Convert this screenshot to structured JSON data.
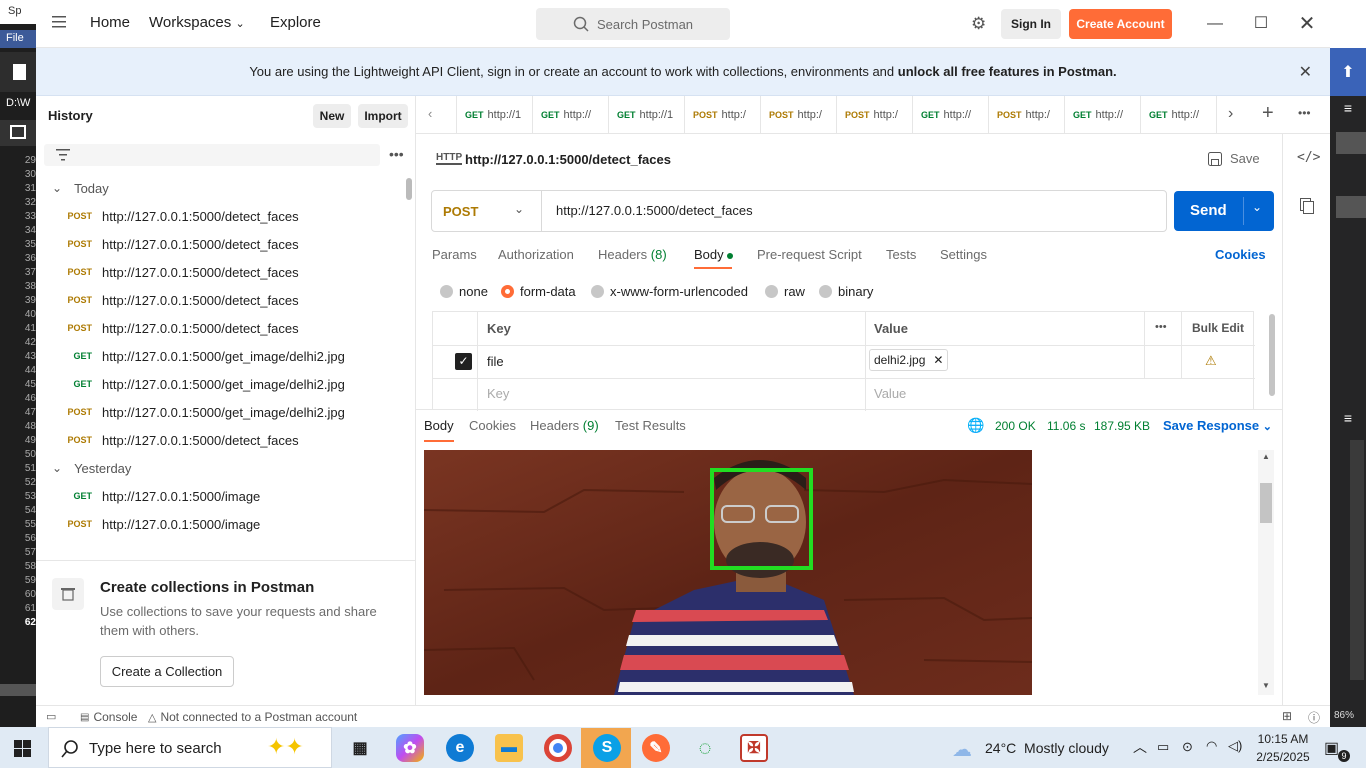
{
  "background_app": {
    "title_prefix": "Sp",
    "menu_file": "File",
    "path_prefix": "D:\\W",
    "line_numbers": [
      "29",
      "30",
      "31",
      "32",
      "33",
      "34",
      "35",
      "36",
      "37",
      "38",
      "39",
      "40",
      "41",
      "42",
      "43",
      "44",
      "45",
      "46",
      "47",
      "48",
      "49",
      "50",
      "51",
      "52",
      "53",
      "54",
      "55",
      "56",
      "57",
      "58",
      "59",
      "60",
      "61",
      "62"
    ],
    "zoom": "86%"
  },
  "header": {
    "home": "Home",
    "workspaces": "Workspaces",
    "explore": "Explore",
    "search_placeholder": "Search Postman",
    "sign_in": "Sign In",
    "create_account": "Create Account"
  },
  "banner": {
    "text": "You are using the Lightweight API Client, sign in or create an account to work with collections, environments and ",
    "bold": "unlock all free features in Postman."
  },
  "sidebar": {
    "title": "History",
    "new_label": "New",
    "import_label": "Import",
    "groups": [
      {
        "label": "Today",
        "items": [
          {
            "method": "POST",
            "url": "http://127.0.0.1:5000/detect_faces"
          },
          {
            "method": "POST",
            "url": "http://127.0.0.1:5000/detect_faces"
          },
          {
            "method": "POST",
            "url": "http://127.0.0.1:5000/detect_faces"
          },
          {
            "method": "POST",
            "url": "http://127.0.0.1:5000/detect_faces"
          },
          {
            "method": "POST",
            "url": "http://127.0.0.1:5000/detect_faces"
          },
          {
            "method": "GET",
            "url": "http://127.0.0.1:5000/get_image/delhi2.jpg"
          },
          {
            "method": "GET",
            "url": "http://127.0.0.1:5000/get_image/delhi2.jpg"
          },
          {
            "method": "POST",
            "url": "http://127.0.0.1:5000/get_image/delhi2.jpg"
          },
          {
            "method": "POST",
            "url": "http://127.0.0.1:5000/detect_faces"
          }
        ]
      },
      {
        "label": "Yesterday",
        "items": [
          {
            "method": "GET",
            "url": "http://127.0.0.1:5000/image"
          },
          {
            "method": "POST",
            "url": "http://127.0.0.1:5000/image"
          }
        ]
      }
    ],
    "promo_title": "Create collections in Postman",
    "promo_text_1": "Use collections to save your requests and share",
    "promo_text_2": "them with others.",
    "promo_button": "Create a Collection"
  },
  "tabs": [
    {
      "method": "GET",
      "label": "http://1"
    },
    {
      "method": "GET",
      "label": "http://"
    },
    {
      "method": "GET",
      "label": "http://1"
    },
    {
      "method": "POST",
      "label": "http:/"
    },
    {
      "method": "POST",
      "label": "http:/"
    },
    {
      "method": "POST",
      "label": "http:/"
    },
    {
      "method": "GET",
      "label": "http://"
    },
    {
      "method": "POST",
      "label": "http:/"
    },
    {
      "method": "GET",
      "label": "http://"
    },
    {
      "method": "GET",
      "label": "http://"
    }
  ],
  "request": {
    "name": "http://127.0.0.1:5000/detect_faces",
    "save": "Save",
    "method": "POST",
    "url": "http://127.0.0.1:5000/detect_faces",
    "send": "Send",
    "subtabs": [
      "Params",
      "Authorization",
      "Headers",
      "Body",
      "Pre-request Script",
      "Tests",
      "Settings"
    ],
    "headers_count": "(8)",
    "cookies": "Cookies",
    "body_types": [
      "none",
      "form-data",
      "x-www-form-urlencoded",
      "raw",
      "binary"
    ],
    "selected_body_type": "form-data",
    "table_key_header": "Key",
    "table_value_header": "Value",
    "bulk_edit": "Bulk Edit",
    "row_key": "file",
    "row_value": "delhi2.jpg",
    "key_placeholder": "Key",
    "value_placeholder": "Value"
  },
  "response": {
    "tabs": [
      "Body",
      "Cookies",
      "Headers",
      "Test Results"
    ],
    "headers_count": "(9)",
    "status": "200 OK",
    "time": "11.06 s",
    "size": "187.95 KB",
    "save_response": "Save Response"
  },
  "footer": {
    "console": "Console",
    "account_status": "Not connected to a Postman account"
  },
  "taskbar": {
    "search_placeholder": "Type here to search",
    "weather": "24°C  Mostly cloudy",
    "time": "10:15 AM",
    "date": "2/25/2025",
    "notifications": "9"
  },
  "colors": {
    "accent_orange": "#ff6c37",
    "send_blue": "#0265d2",
    "post_color": "#ad7a03",
    "get_color": "#007f31",
    "status_green": "#007f31",
    "face_box": "#22dd22"
  }
}
